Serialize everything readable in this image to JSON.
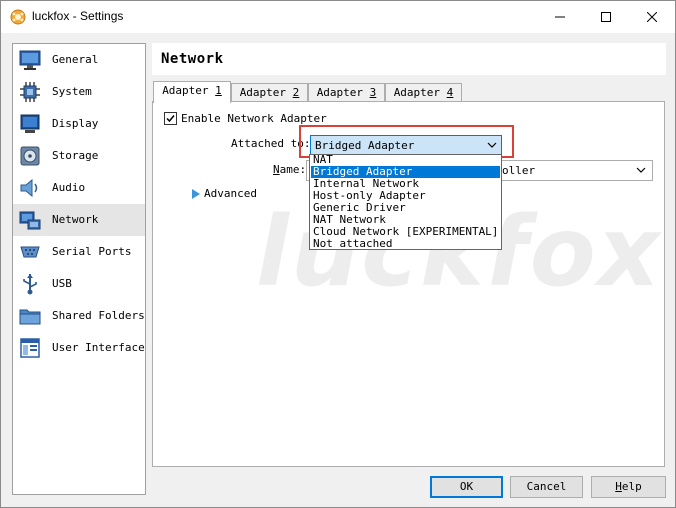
{
  "window": {
    "title": "luckfox - Settings"
  },
  "sidebar": {
    "items": [
      {
        "label": "General",
        "icon": "monitor-icon"
      },
      {
        "label": "System",
        "icon": "chip-icon"
      },
      {
        "label": "Display",
        "icon": "display-icon"
      },
      {
        "label": "Storage",
        "icon": "disk-icon"
      },
      {
        "label": "Audio",
        "icon": "speaker-icon"
      },
      {
        "label": "Network",
        "icon": "network-icon",
        "selected": true
      },
      {
        "label": "Serial Ports",
        "icon": "serial-port-icon"
      },
      {
        "label": "USB",
        "icon": "usb-icon"
      },
      {
        "label": "Shared Folders",
        "icon": "folder-icon"
      },
      {
        "label": "User Interface",
        "icon": "window-icon"
      }
    ]
  },
  "header": {
    "title": "Network"
  },
  "tabs": [
    {
      "prefix": "Adapter ",
      "key": "1",
      "selected": true
    },
    {
      "prefix": "Adapter ",
      "key": "2"
    },
    {
      "prefix": "Adapter ",
      "key": "3"
    },
    {
      "prefix": "Adapter ",
      "key": "4"
    }
  ],
  "adapter": {
    "enable_label": "Enable Network Adapter",
    "enabled": true,
    "attached_label": "Attached to:",
    "attached_value": "Bridged Adapter",
    "name_label_prefix": "",
    "name_label_key": "N",
    "name_label_rest": "ame:",
    "name_value": "oller",
    "advanced_label": "Advanced"
  },
  "dropdown": {
    "options": [
      "NAT",
      "Bridged Adapter",
      "Internal Network",
      "Host-only Adapter",
      "Generic Driver",
      "NAT Network",
      "Cloud Network [EXPERIMENTAL]",
      "Not attached"
    ],
    "selected_index": 1
  },
  "watermark": "luckfox",
  "buttons": {
    "ok": "OK",
    "cancel": "Cancel",
    "help_key": "H",
    "help_rest": "elp"
  },
  "colors": {
    "selection": "#0078d7",
    "highlight": "#d9403a"
  }
}
